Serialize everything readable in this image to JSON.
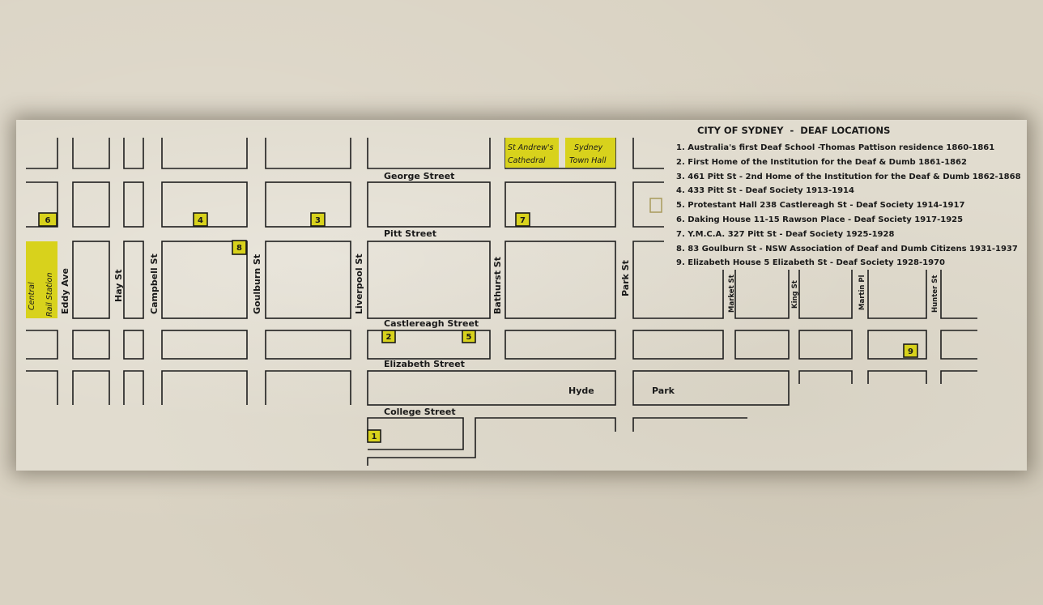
{
  "map": {
    "title": "CITY OF SYDNEY  -  DEAF LOCATIONS",
    "legend": [
      "1. Australia's first Deaf School -Thomas Pattison residence 1860-1861",
      "2. First Home of the Institution for the Deaf & Dumb 1861-1862",
      "3. 461 Pitt St - 2nd Home of the Institution for the Deaf & Dumb 1862-1868",
      "4. 433 Pitt St - Deaf Society  1913-1914",
      "5. Protestant Hall 238 Castlereagh St - Deaf Society 1914-1917",
      "6. Daking House 11-15 Rawson Place - Deaf Society 1917-1925",
      "7. Y.M.C.A. 327 Pitt St - Deaf Society 1925-1928",
      "8. 83 Goulburn St - NSW Association of Deaf and Dumb Citizens 1931-1937",
      "9. Elizabeth House 5 Elizabeth St - Deaf Society 1928-1970"
    ],
    "streets": {
      "george": "George Street",
      "pitt": "Pitt Street",
      "castlereagh": "Castlereagh Street",
      "elizabeth": "Elizabeth Street",
      "college": "College Street",
      "eddy": "Eddy Ave",
      "hay": "Hay  St",
      "campbell": "Campbell St",
      "goulburn": "Goulburn St",
      "liverpool": "Liverpool St",
      "bathurst": "Bathurst St",
      "park": "Park St",
      "market": "Market St",
      "king": "King St",
      "martin": "Martin Pl",
      "hunter": "Hunter St"
    },
    "landmarks": {
      "st_andrews_1": "St Andrew's",
      "st_andrews_2": "Cathedral",
      "town_hall_1": "Sydney",
      "town_hall_2": "Town Hall",
      "central_1": "Central",
      "central_2": "Rail Station",
      "hyde": "Hyde",
      "park": "Park"
    },
    "markers": {
      "m1": "1",
      "m2": "2",
      "m3": "3",
      "m4": "4",
      "m5": "5",
      "m6": "6",
      "m7": "7",
      "m8": "8",
      "m9": "9"
    },
    "colors": {
      "highlight": "#d8d21c",
      "ink": "#1e1e1e",
      "paper": "#e1dccf"
    }
  }
}
